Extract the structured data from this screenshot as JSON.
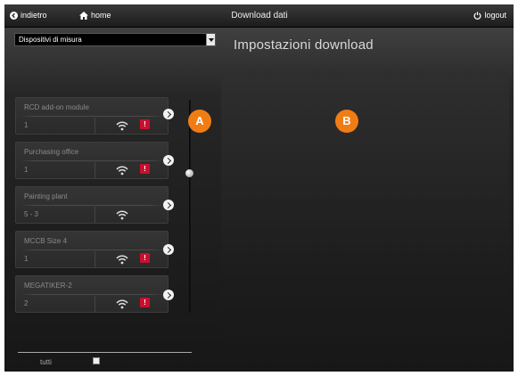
{
  "nav": {
    "back_label": "indietro",
    "home_label": "home",
    "title": "Download dati",
    "logout_label": "logout"
  },
  "selector": {
    "value": "Dispositivi di misura"
  },
  "panel": {
    "title": "Impostazioni download"
  },
  "devices": [
    {
      "name": "RCD add-on module",
      "value": "1",
      "wifi": true,
      "alert": true
    },
    {
      "name": "Purchasing office",
      "value": "1",
      "wifi": true,
      "alert": true
    },
    {
      "name": "Painting plant",
      "value": "5 - 3",
      "wifi": true,
      "alert": false
    },
    {
      "name": "MCCB Size 4",
      "value": "1",
      "wifi": true,
      "alert": true
    },
    {
      "name": "MEGATIKER-2",
      "value": "2",
      "wifi": true,
      "alert": true
    }
  ],
  "alert_glyph": "!",
  "badges": {
    "a": "A",
    "b": "B"
  },
  "footer": {
    "all_label": "tutti"
  },
  "colors": {
    "accent": "#f07d14",
    "alert": "#c8102e"
  }
}
